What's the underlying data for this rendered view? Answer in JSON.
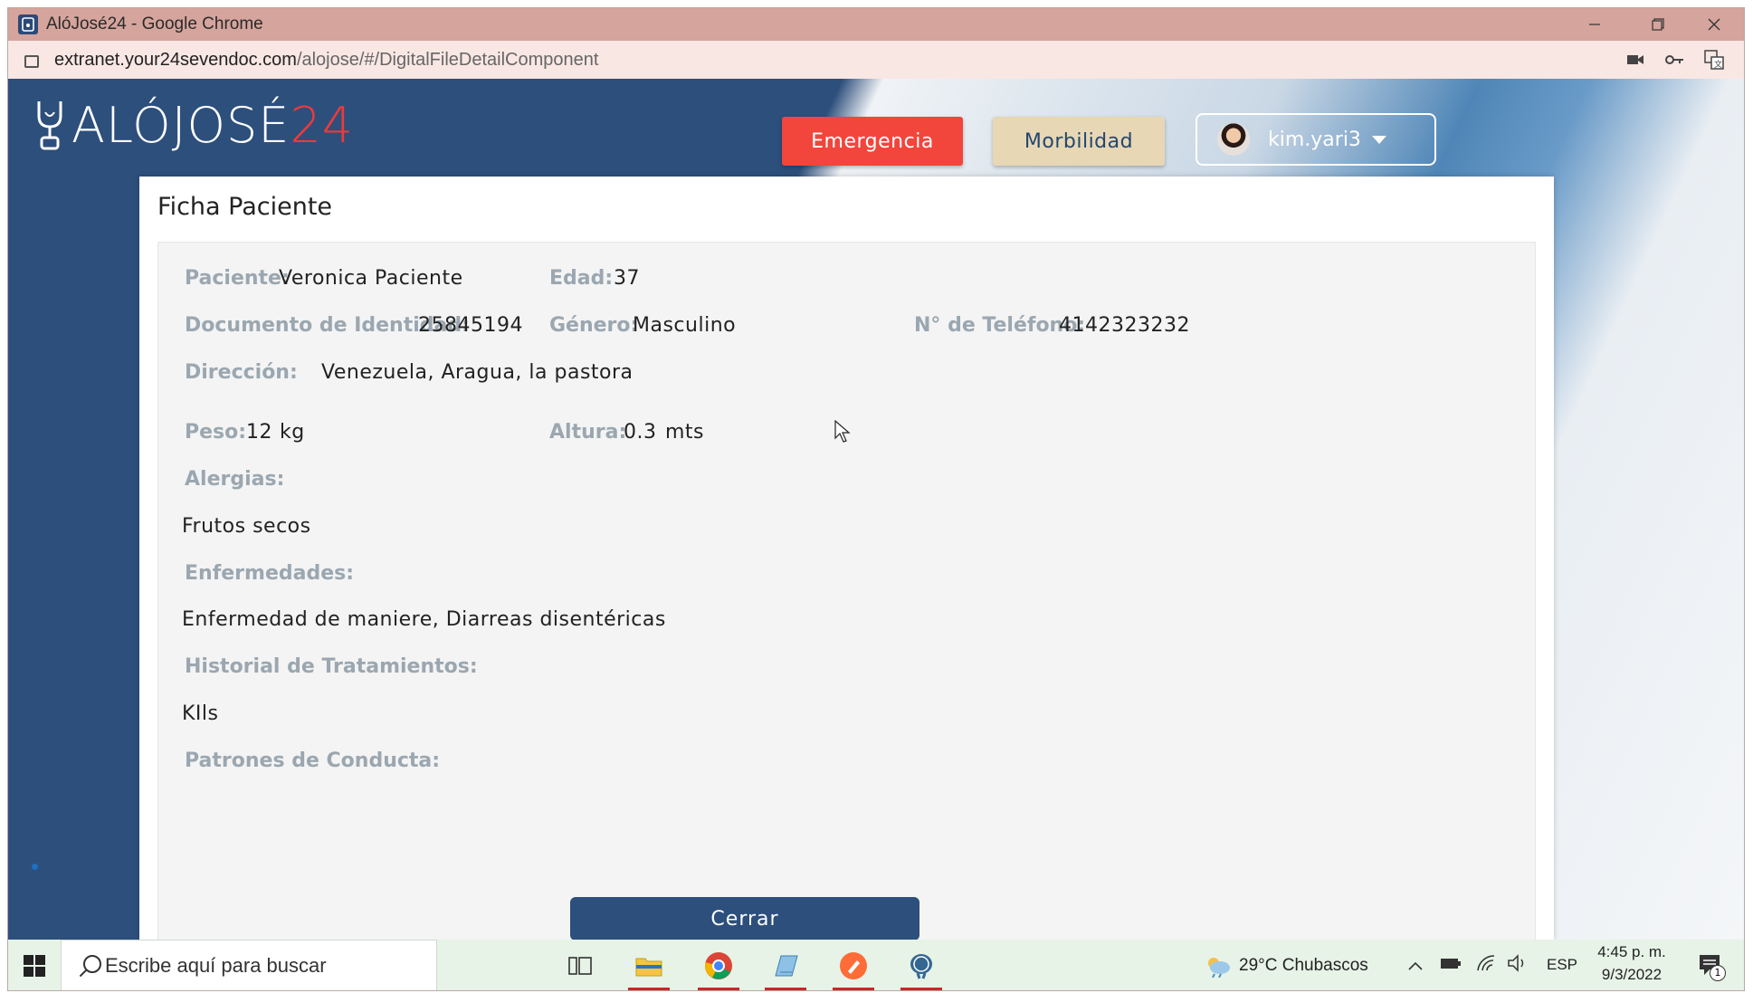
{
  "browser": {
    "window_title": "AlóJosé24 - Google Chrome",
    "url_domain": "extranet.your24sevendoc.com",
    "url_path": "/alojose/#/DigitalFileDetailComponent"
  },
  "header": {
    "logo_text": "ALÓJOSÉ",
    "logo_number": "24",
    "emergency_label": "Emergencia",
    "morbidity_label": "Morbilidad",
    "username": "kim.yari3"
  },
  "card": {
    "title": "Ficha Paciente",
    "fields": {
      "patient_label": "Paciente:",
      "patient_value": "Veronica Paciente",
      "age_label": "Edad:",
      "age_value": "37",
      "id_label": "Documento de Identidad:",
      "id_value": "25845194",
      "gender_label": "Género:",
      "gender_value": "Masculino",
      "phone_label": "N° de Teléfono:",
      "phone_value": "4142323232",
      "address_label": "Dirección:",
      "address_value": "Venezuela, Aragua, la pastora",
      "weight_label": "Peso:",
      "weight_value": "12",
      "weight_unit": "kg",
      "height_label": "Altura:",
      "height_value": "0.3",
      "height_unit": "mts",
      "allergies_label": "Alergias:",
      "allergies_value": "Frutos secos",
      "diseases_label": "Enfermedades:",
      "diseases_value": "Enfermedad de maniere, Diarreas disentéricas",
      "treatments_label": "Historial de Tratamientos:",
      "treatments_value": "KIls",
      "behavior_label": "Patrones de Conducta:"
    },
    "close_label": "Cerrar"
  },
  "taskbar": {
    "search_placeholder": "Escribe aquí para buscar",
    "weather": "29°C  Chubascos",
    "language": "ESP",
    "time": "4:45 p. m.",
    "date": "9/3/2022",
    "notification_count": "1"
  },
  "colors": {
    "brand_blue": "#2d4f7c",
    "emergency_red": "#f2453c",
    "morbidity_beige": "#e7d7b4",
    "label_grey": "#9ba7b0"
  }
}
